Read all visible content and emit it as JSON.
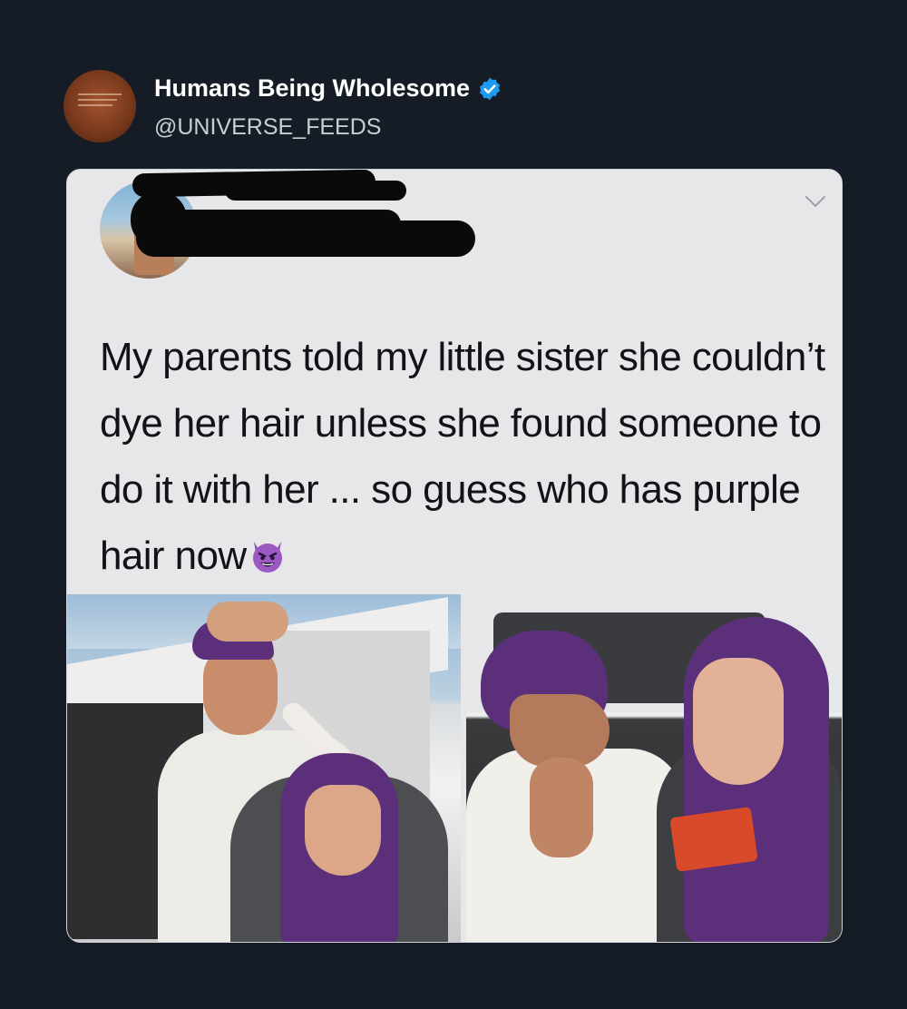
{
  "account": {
    "display_name": "Humans Being Wholesome",
    "handle": "@UNIVERSE_FEEDS",
    "verified": true,
    "verified_color": "#1d9bf0"
  },
  "embedded_tweet": {
    "text": "My parents told my little sister she couldn’t dye her hair unless she found someone to do it with her ... so guess who has purple hair now",
    "emoji": "smiling-face-with-horns",
    "menu_icon": "chevron-down-icon"
  },
  "colors": {
    "background": "#151c26",
    "card": "#e7e7e9",
    "hair_purple": "#5b2f7a"
  }
}
